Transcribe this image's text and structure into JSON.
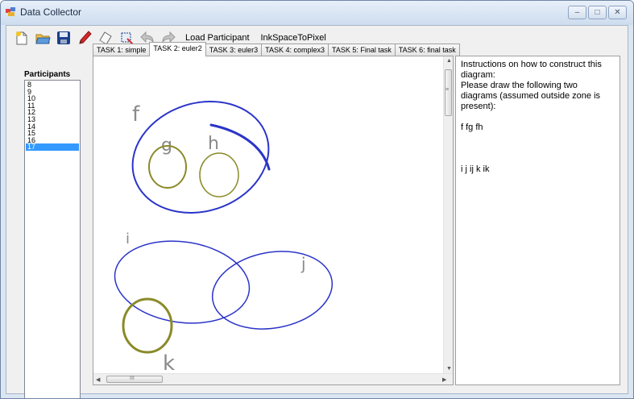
{
  "window": {
    "title": "Data Collector",
    "controls": {
      "minimize": "–",
      "maximize": "□",
      "close": "✕"
    }
  },
  "toolbar": {
    "icons": [
      "new-file-icon",
      "open-folder-icon",
      "save-disk-icon",
      "pen-icon",
      "eraser-icon",
      "select-icon",
      "undo-icon",
      "redo-icon"
    ],
    "load_participant": "Load Participant",
    "ink_space_to_pixel": "InkSpaceToPixel"
  },
  "participants": {
    "label": "Participants",
    "items": [
      "8",
      "9",
      "10",
      "11",
      "12",
      "13",
      "14",
      "15",
      "16",
      "17"
    ],
    "selected": "17"
  },
  "tabs": [
    {
      "label": "TASK 1: simple",
      "active": false
    },
    {
      "label": "TASK 2: euler2",
      "active": true
    },
    {
      "label": "TASK 3: euler3",
      "active": false
    },
    {
      "label": "TASK 4: complex3",
      "active": false
    },
    {
      "label": "TASK 5: Final task",
      "active": false
    },
    {
      "label": "TASK 6: final task",
      "active": false
    }
  ],
  "canvas": {
    "labels": {
      "f": "f",
      "g": "g",
      "h": "h",
      "i": "i",
      "j": "j",
      "k": "k"
    },
    "colors": {
      "blue": "#2a34c9",
      "olive": "#8a8a2a",
      "gray": "#8a8a8a"
    }
  },
  "scrollbar": {
    "grip": "≡",
    "h_grip": "III"
  },
  "instructions": {
    "line1": "Instructions on how to construct this diagram:",
    "line2": "Please draw the following two diagrams (assumed outside zone is present):",
    "diagram1": "f fg fh",
    "diagram2": "i j ij k ik"
  }
}
